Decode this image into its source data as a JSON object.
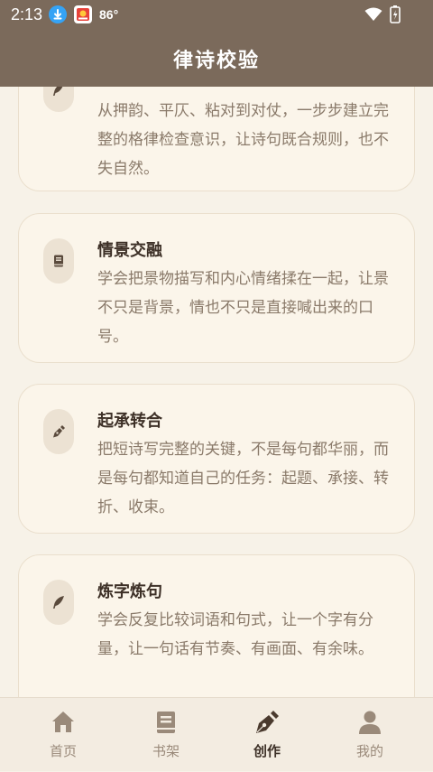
{
  "status_bar": {
    "time": "2:13",
    "temperature": "86°",
    "icons": [
      "download-icon",
      "app-notification-icon",
      "wifi-icon",
      "battery-icon"
    ]
  },
  "app_bar": {
    "title": "律诗校验"
  },
  "cards": [
    {
      "title": "",
      "icon": "quill-icon",
      "desc": "从押韵、平仄、粘对到对仗，一步步建立完整的格律检查意识，让诗句既合规则，也不失自然。"
    },
    {
      "title": "情景交融",
      "icon": "book-icon",
      "desc": "学会把景物描写和内心情绪揉在一起，让景不只是背景，情也不只是直接喊出来的口号。"
    },
    {
      "title": "起承转合",
      "icon": "pen-nib-icon",
      "desc": "把短诗写完整的关键，不是每句都华丽，而是每句都知道自己的任务：起题、承接、转折、收束。"
    },
    {
      "title": "炼字炼句",
      "icon": "quill-icon",
      "desc": "学会反复比较词语和句式，让一个字有分量，让一句话有节奏、有画面、有余味。"
    }
  ],
  "bottom_nav": [
    {
      "label": "首页",
      "icon": "home-icon",
      "active": false
    },
    {
      "label": "书架",
      "icon": "book-icon",
      "active": false
    },
    {
      "label": "创作",
      "icon": "pen-nib-icon",
      "active": true
    },
    {
      "label": "我的",
      "icon": "person-icon",
      "active": false
    }
  ],
  "colors": {
    "header": "#7b6a5b",
    "background": "#f7f2e8",
    "card": "#fbf5ea",
    "title_text": "#3d3027",
    "body_text": "#8a7a6a",
    "nav_inactive": "#9a8a7a"
  }
}
